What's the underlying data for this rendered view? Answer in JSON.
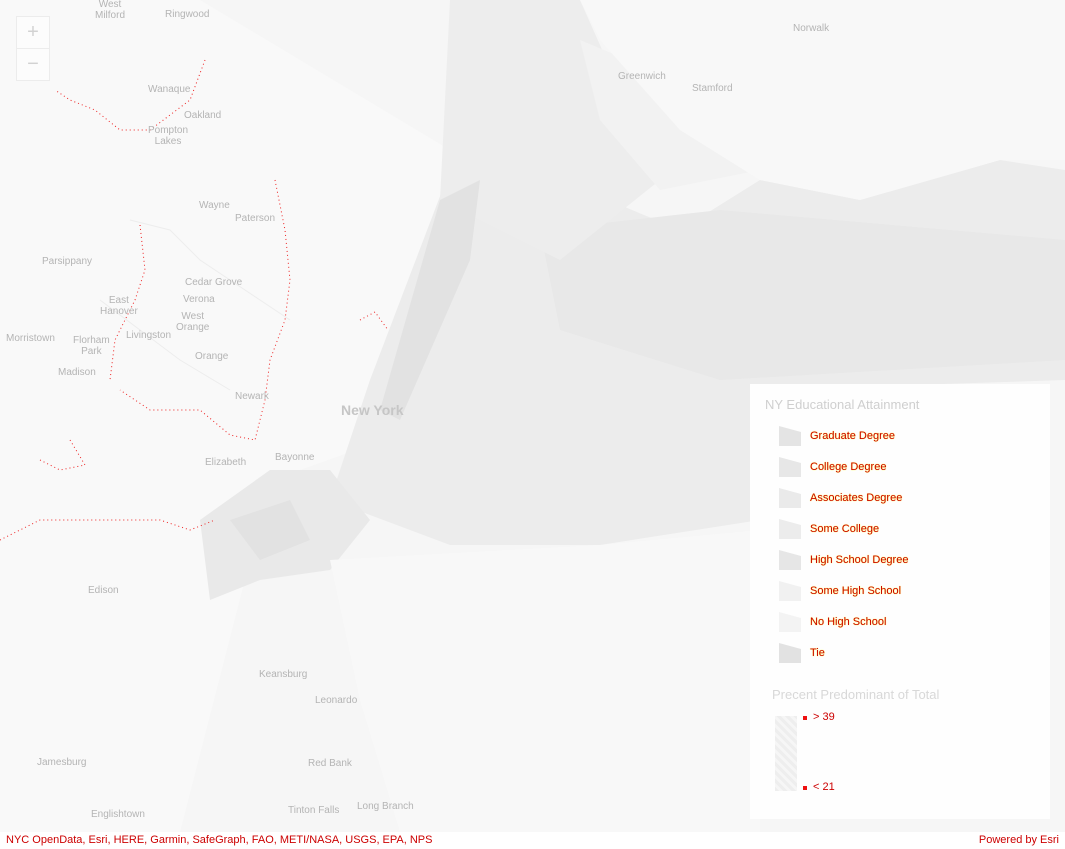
{
  "zoom_controls": {
    "zoom_in": "+",
    "zoom_out": "−"
  },
  "places": [
    {
      "id": "west-milford",
      "label": "West\nMilford",
      "type": "town"
    },
    {
      "id": "ringwood",
      "label": "Ringwood",
      "type": "town"
    },
    {
      "id": "norwalk",
      "label": "Norwalk",
      "type": "town"
    },
    {
      "id": "greenwich",
      "label": "Greenwich",
      "type": "town"
    },
    {
      "id": "stamford",
      "label": "Stamford",
      "type": "town"
    },
    {
      "id": "wanaque",
      "label": "Wanaque",
      "type": "town"
    },
    {
      "id": "oakland",
      "label": "Oakland",
      "type": "town"
    },
    {
      "id": "pompton-lakes",
      "label": "Pompton\nLakes",
      "type": "town"
    },
    {
      "id": "wayne",
      "label": "Wayne",
      "type": "town"
    },
    {
      "id": "paterson",
      "label": "Paterson",
      "type": "town"
    },
    {
      "id": "parsippany",
      "label": "Parsippany",
      "type": "town"
    },
    {
      "id": "cedar-grove",
      "label": "Cedar Grove",
      "type": "town"
    },
    {
      "id": "east-hanover",
      "label": "East\nHanover",
      "type": "town"
    },
    {
      "id": "verona",
      "label": "Verona",
      "type": "town"
    },
    {
      "id": "west-orange",
      "label": "West\nOrange",
      "type": "town"
    },
    {
      "id": "livingston",
      "label": "Livingston",
      "type": "town"
    },
    {
      "id": "morristown",
      "label": "Morristown",
      "type": "town"
    },
    {
      "id": "florham-park",
      "label": "Florham\nPark",
      "type": "town"
    },
    {
      "id": "orange",
      "label": "Orange",
      "type": "town"
    },
    {
      "id": "madison",
      "label": "Madison",
      "type": "town"
    },
    {
      "id": "newark",
      "label": "Newark",
      "type": "town"
    },
    {
      "id": "new-york",
      "label": "New York",
      "type": "city"
    },
    {
      "id": "elizabeth",
      "label": "Elizabeth",
      "type": "town"
    },
    {
      "id": "bayonne",
      "label": "Bayonne",
      "type": "town"
    },
    {
      "id": "edison",
      "label": "Edison",
      "type": "town"
    },
    {
      "id": "keansburg",
      "label": "Keansburg",
      "type": "town"
    },
    {
      "id": "leonardo",
      "label": "Leonardo",
      "type": "town"
    },
    {
      "id": "jamesburg",
      "label": "Jamesburg",
      "type": "town"
    },
    {
      "id": "red-bank",
      "label": "Red Bank",
      "type": "town"
    },
    {
      "id": "englishtown",
      "label": "Englishtown",
      "type": "town"
    },
    {
      "id": "tinton-falls",
      "label": "Tinton Falls",
      "type": "town"
    },
    {
      "id": "long-branch",
      "label": "Long Branch",
      "type": "town"
    }
  ],
  "legend": {
    "title": "NY Educational Attainment",
    "categories": [
      {
        "label": "Graduate Degree",
        "color": "#e4e4e4"
      },
      {
        "label": "College Degree",
        "color": "#e7e7e7"
      },
      {
        "label": "Associates Degree",
        "color": "#eaeaea"
      },
      {
        "label": "Some College",
        "color": "#ececec"
      },
      {
        "label": "High School Degree",
        "color": "#e6e6e6"
      },
      {
        "label": "Some High School",
        "color": "#f1f1f1"
      },
      {
        "label": "No High School",
        "color": "#f3f3f3"
      },
      {
        "label": "Tie",
        "color": "#e2e2e2"
      }
    ],
    "size_title": "Precent Predominant of Total",
    "size_max_label": "> 39",
    "size_min_label": "< 21"
  },
  "attribution": {
    "sources": "NYC OpenData, Esri, HERE, Garmin, SafeGraph, FAO, METI/NASA, USGS, EPA, NPS",
    "powered_by": "Powered by Esri"
  }
}
